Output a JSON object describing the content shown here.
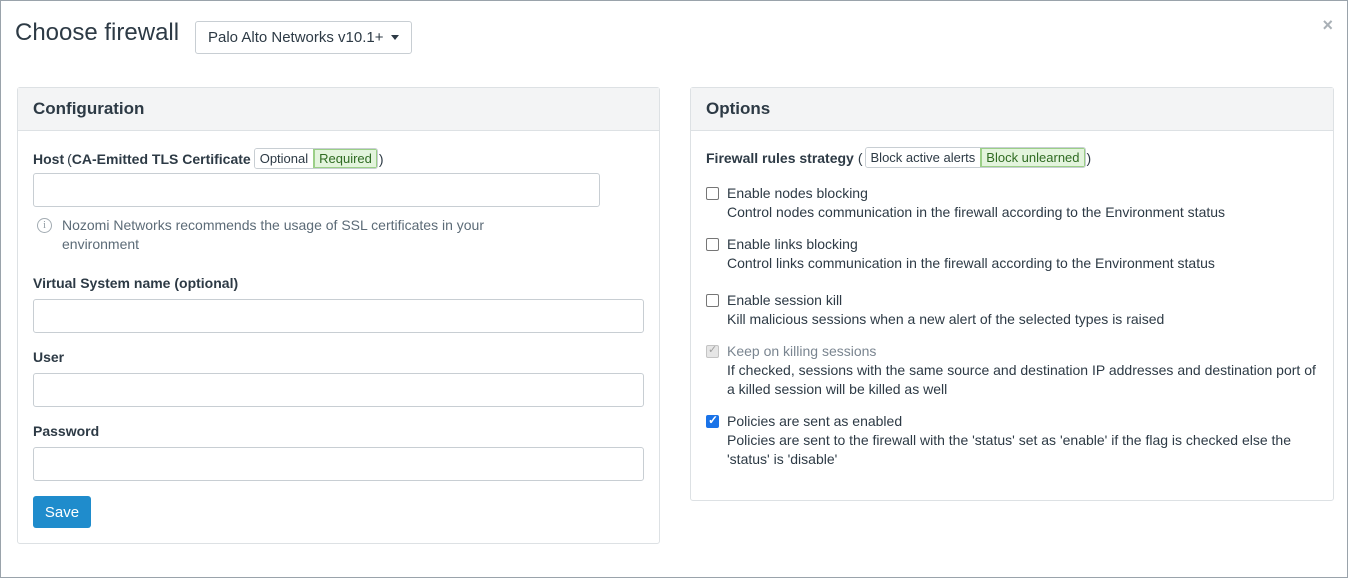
{
  "modal": {
    "title": "Choose firewall",
    "vendor_selected": "Palo Alto Networks v10.1+",
    "close": "×"
  },
  "config": {
    "heading": "Configuration",
    "host_label": "Host",
    "host_paren_open": "(",
    "host_cert_label": "CA-Emitted TLS Certificate",
    "cert_options": [
      "Optional",
      "Required"
    ],
    "cert_selected": "Required",
    "host_paren_close": ")",
    "host_value": "",
    "info_text": "Nozomi Networks recommends the usage of SSL certificates in your environment",
    "vsys_label": "Virtual System name (optional)",
    "vsys_value": "",
    "user_label": "User",
    "user_value": "",
    "password_label": "Password",
    "password_value": "",
    "save_label": "Save"
  },
  "options": {
    "heading": "Options",
    "strategy_label": "Firewall rules strategy",
    "strategy_paren_open": "(",
    "strategy_options": [
      "Block active alerts",
      "Block unlearned"
    ],
    "strategy_selected": "Block unlearned",
    "strategy_paren_close": ")",
    "items": [
      {
        "title": "Enable nodes blocking",
        "desc": "Control nodes communication in the firewall according to the Environment status",
        "checked": false,
        "disabled": false
      },
      {
        "title": "Enable links blocking",
        "desc": "Control links communication in the firewall according to the Environment status",
        "checked": false,
        "disabled": false
      },
      {
        "title": "Enable session kill",
        "desc": "Kill malicious sessions when a new alert of the selected types is raised",
        "checked": false,
        "disabled": false
      },
      {
        "title": "Keep on killing sessions",
        "desc": "If checked, sessions with the same source and destination IP addresses and destination port of a killed session will be killed as well",
        "checked": true,
        "disabled": true
      },
      {
        "title": "Policies are sent as enabled",
        "desc": "Policies are sent to the firewall with the 'status' set as 'enable' if the flag is checked else the 'status' is 'disable'",
        "checked": true,
        "disabled": false
      }
    ]
  },
  "colors": {
    "save_button": "#1f8ccc",
    "segment_active_bg": "#e3f4dd",
    "checkbox_checked": "#1a73e8"
  }
}
